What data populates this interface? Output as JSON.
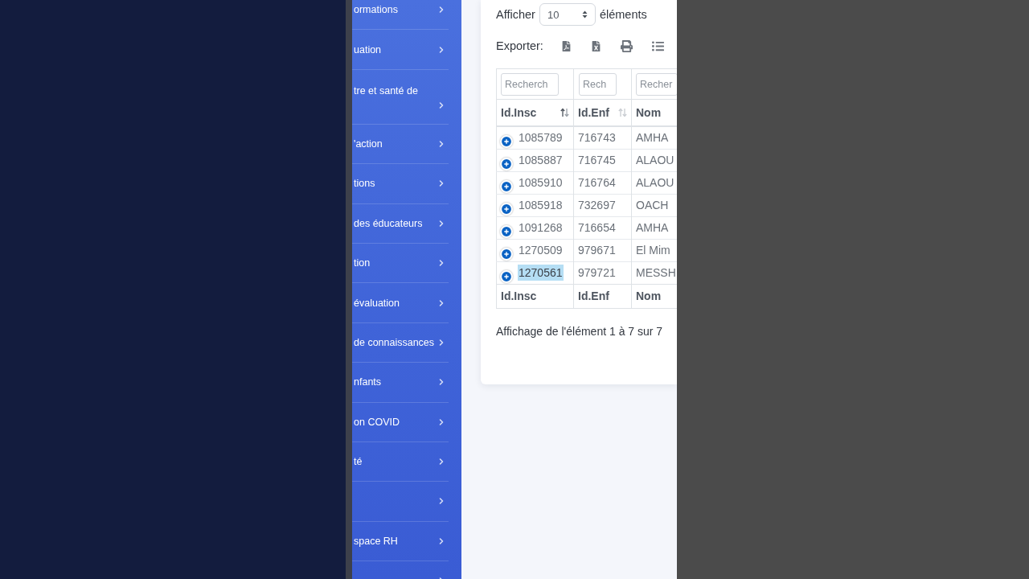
{
  "sidebar": {
    "items": [
      {
        "kind": "single",
        "label": "ormations"
      },
      {
        "kind": "single",
        "label": "uation"
      },
      {
        "kind": "wrapped",
        "label": "tre et santé de"
      },
      {
        "kind": "single",
        "label": "'action"
      },
      {
        "kind": "single",
        "label": "tions"
      },
      {
        "kind": "single",
        "label": "des éducateurs"
      },
      {
        "kind": "single",
        "label": "tion"
      },
      {
        "kind": "single",
        "label": "évaluation"
      },
      {
        "kind": "single",
        "label": "de connaissances"
      },
      {
        "kind": "single",
        "label": "nfants"
      },
      {
        "kind": "single",
        "label": "on COVID"
      },
      {
        "kind": "single",
        "label": "té"
      },
      {
        "kind": "single"
      },
      {
        "kind": "single",
        "label": "space RH"
      },
      {
        "kind": "single"
      }
    ]
  },
  "toolbar": {
    "show_label": "Afficher",
    "page_size": "10",
    "entries_label": "éléments",
    "export_label": "Exporter:"
  },
  "table": {
    "filters": [
      {
        "placeholder": "Recherch"
      },
      {
        "placeholder": "Rech"
      },
      {
        "placeholder": "Recher"
      }
    ],
    "columns": [
      {
        "label": "Id.Insc",
        "sorted": true
      },
      {
        "label": "Id.Enf",
        "sorted": false
      },
      {
        "label": "Nom"
      }
    ],
    "rows": [
      {
        "id_insc": "1085789",
        "id_enf": "716743",
        "nom": "AMHA",
        "highlighted": false
      },
      {
        "id_insc": "1085887",
        "id_enf": "716745",
        "nom": "ALAOU",
        "highlighted": false
      },
      {
        "id_insc": "1085910",
        "id_enf": "716764",
        "nom": "ALAOU",
        "highlighted": false
      },
      {
        "id_insc": "1085918",
        "id_enf": "732697",
        "nom": "OACH",
        "highlighted": false
      },
      {
        "id_insc": "1091268",
        "id_enf": "716654",
        "nom": "AMHA",
        "highlighted": false
      },
      {
        "id_insc": "1270509",
        "id_enf": "979671",
        "nom": "El Mim",
        "highlighted": false
      },
      {
        "id_insc": "1270561",
        "id_enf": "979721",
        "nom": "MESSH",
        "highlighted": true
      }
    ],
    "footer": [
      "Id.Insc",
      "Id.Enf",
      "Nom"
    ]
  },
  "info": "Affichage de l'élément 1 à 7 sur 7"
}
